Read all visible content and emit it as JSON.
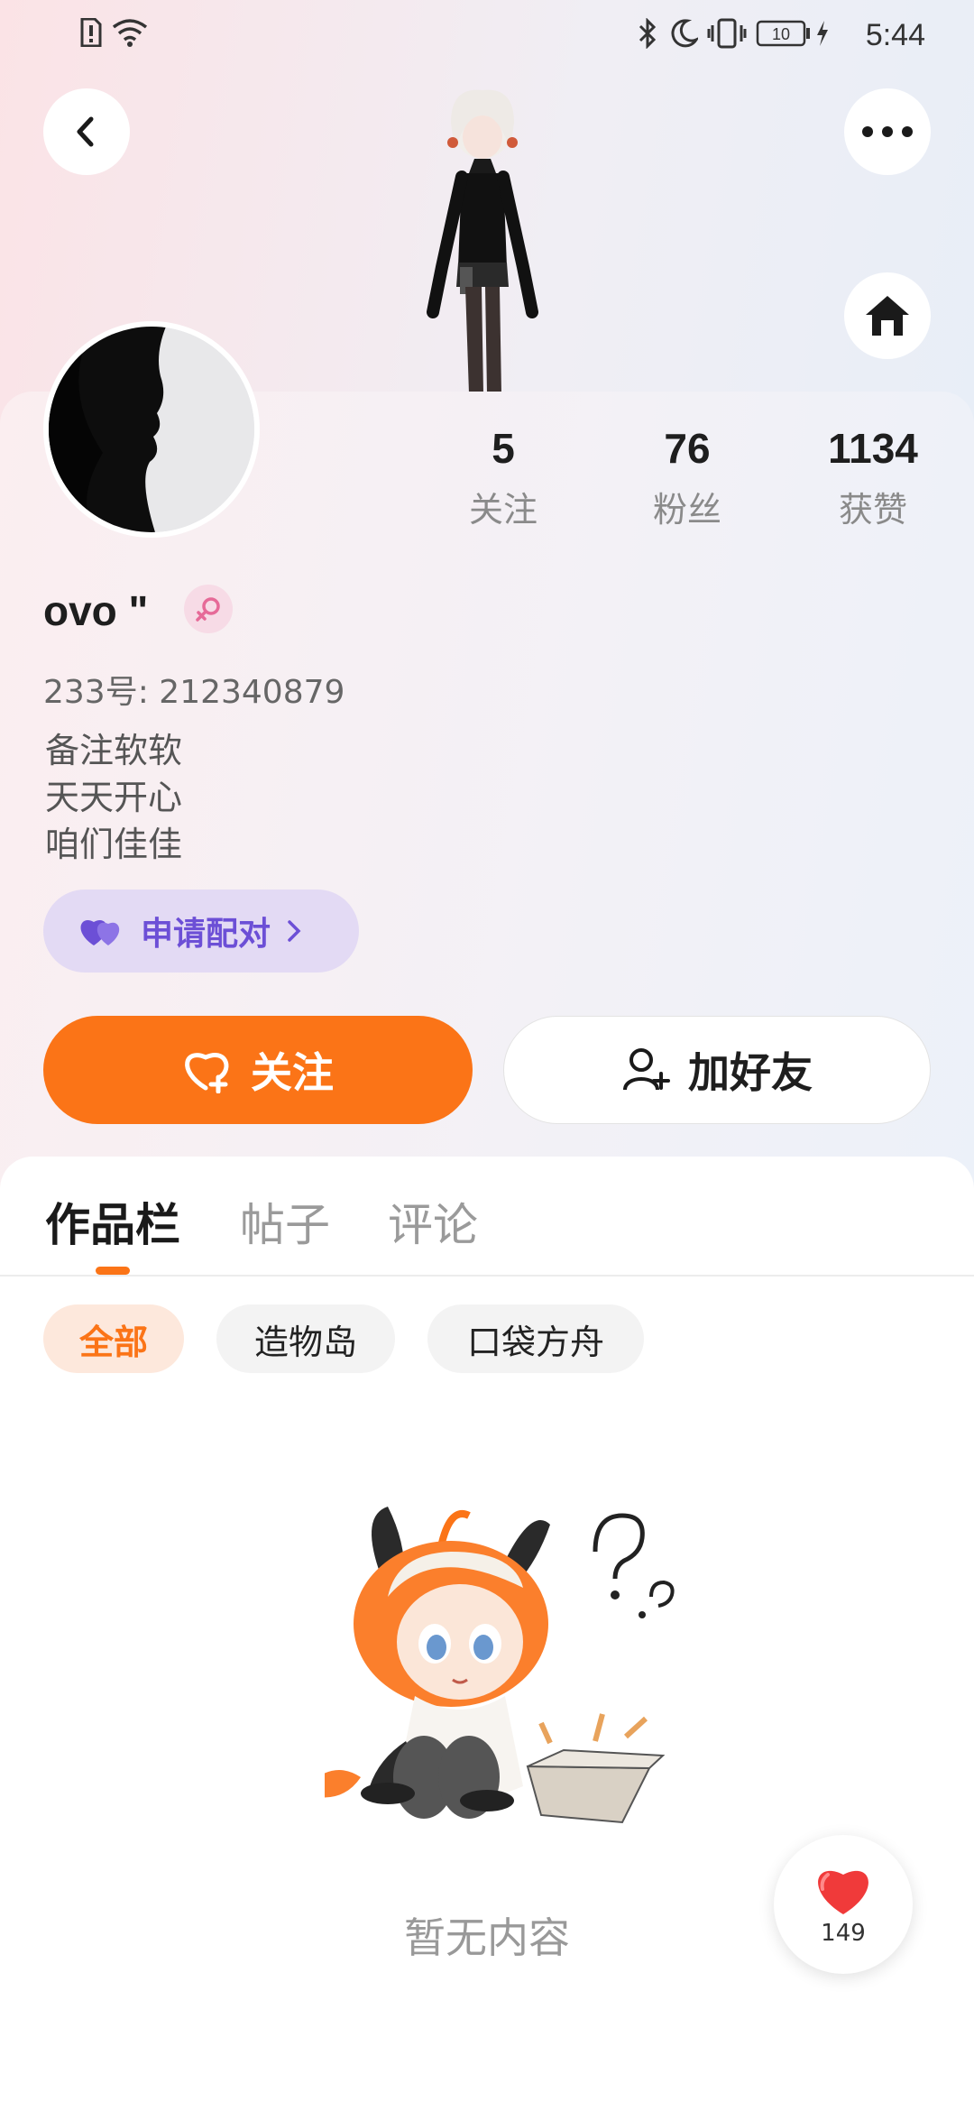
{
  "status_bar": {
    "time": "5:44",
    "battery": "10"
  },
  "stats": [
    {
      "value": "5",
      "label": "关注"
    },
    {
      "value": "76",
      "label": "粉丝"
    },
    {
      "value": "1134",
      "label": "获赞"
    }
  ],
  "profile": {
    "name": "ovo \"",
    "id_line": "233号: 212340879",
    "bio": "备注软软\n天天开心\n咱们佳佳"
  },
  "pair_button": {
    "label": "申请配对"
  },
  "actions": {
    "follow": "关注",
    "add_friend": "加好友"
  },
  "tabs": [
    "作品栏",
    "帖子",
    "评论"
  ],
  "filters": [
    "全部",
    "造物岛",
    "口袋方舟"
  ],
  "empty_state": {
    "text": "暂无内容"
  },
  "float_like": {
    "count": "149"
  },
  "colors": {
    "accent": "#fb7417",
    "pair": "#6c4fd6",
    "heart": "#f03a3a"
  }
}
